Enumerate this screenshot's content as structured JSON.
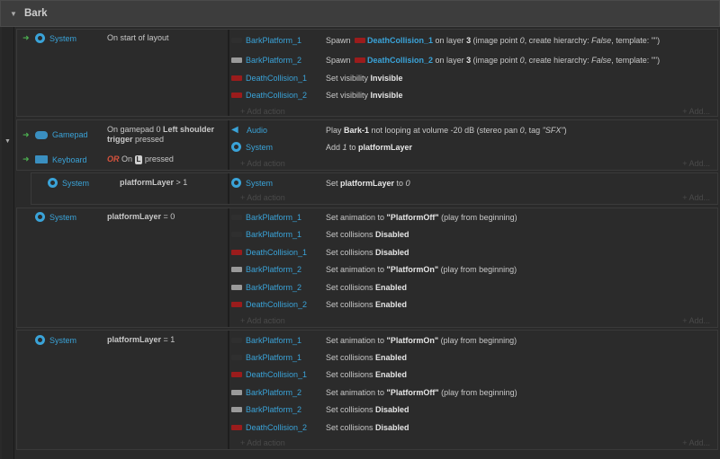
{
  "group": {
    "toggle": "▼",
    "title": "Bark"
  },
  "gutter": {
    "arrow": "▼"
  },
  "labels": {
    "add_action": "+ Add action",
    "add_more": "+ Add..."
  },
  "events": [
    {
      "conditions": [
        {
          "trigger": "➜",
          "icon": "gear-icon",
          "object": "System",
          "desc": "On start of layout"
        }
      ],
      "actions": [
        {
          "thumb": "dark",
          "object": "BarkPlatform_1"
        },
        {
          "thumb": "grey",
          "object": "BarkPlatform_2"
        },
        {
          "thumb": "red",
          "object": "DeathCollision_1",
          "text": [
            "Set visibility ",
            "Invisible"
          ]
        },
        {
          "thumb": "red",
          "object": "DeathCollision_2",
          "text": [
            "Set visibility ",
            "Invisible"
          ]
        }
      ],
      "spawn1": [
        "Spawn ",
        "DeathCollision_1",
        " on layer ",
        "3",
        " (image point ",
        "0",
        ", create hierarchy: ",
        "False",
        ", template: \"\")"
      ],
      "spawn2": [
        "Spawn ",
        "DeathCollision_2",
        " on layer ",
        "3",
        " (image point ",
        "0",
        ", create hierarchy: ",
        "False",
        ", template: \"\")"
      ]
    },
    {
      "conditions": [
        {
          "trigger": "➜",
          "icon": "gamepad-icon",
          "object": "Gamepad",
          "desc_a": "On gamepad 0 ",
          "desc_b": "Left shoulder trigger",
          "desc_c": " pressed"
        },
        {
          "trigger": "➜",
          "icon": "keyboard-icon",
          "object": "Keyboard",
          "or": "OR",
          "on": " On ",
          "key": "L",
          "pressed": " pressed"
        }
      ],
      "actions": [
        {
          "icon": "audio-icon",
          "object": "Audio",
          "text": [
            "Play ",
            "Bark-1",
            " not looping at volume -20 dB (stereo pan ",
            "0",
            ", tag ",
            "\"SFX\"",
            ")"
          ]
        },
        {
          "icon": "gear-icon",
          "object": "System",
          "text": [
            "Add ",
            "1",
            " to ",
            "platformLayer"
          ]
        }
      ]
    },
    {
      "conditions": [
        {
          "icon": "gear-icon",
          "object": "System",
          "var": "platformLayer",
          "op": " > 1"
        }
      ],
      "actions": [
        {
          "icon": "gear-icon",
          "object": "System",
          "text": [
            "Set ",
            "platformLayer",
            " to ",
            "0"
          ]
        }
      ]
    },
    {
      "conditions": [
        {
          "icon": "gear-icon",
          "object": "System",
          "var": "platformLayer",
          "op": " = 0"
        }
      ],
      "actions": [
        {
          "thumb": "dark",
          "object": "BarkPlatform_1",
          "text": [
            "Set animation to ",
            "\"PlatformOff\"",
            " (play from beginning)"
          ]
        },
        {
          "thumb": "dark",
          "object": "BarkPlatform_1",
          "text": [
            "Set collisions ",
            "Disabled"
          ]
        },
        {
          "thumb": "red",
          "object": "DeathCollision_1",
          "text": [
            "Set collisions ",
            "Disabled"
          ]
        },
        {
          "thumb": "grey",
          "object": "BarkPlatform_2",
          "text": [
            "Set animation to ",
            "\"PlatformOn\"",
            " (play from beginning)"
          ]
        },
        {
          "thumb": "grey",
          "object": "BarkPlatform_2",
          "text": [
            "Set collisions ",
            "Enabled"
          ]
        },
        {
          "thumb": "red",
          "object": "DeathCollision_2",
          "text": [
            "Set collisions ",
            "Enabled"
          ]
        }
      ]
    },
    {
      "conditions": [
        {
          "icon": "gear-icon",
          "object": "System",
          "var": "platformLayer",
          "op": " = 1"
        }
      ],
      "actions": [
        {
          "thumb": "dark",
          "object": "BarkPlatform_1",
          "text": [
            "Set animation to ",
            "\"PlatformOn\"",
            " (play from beginning)"
          ]
        },
        {
          "thumb": "dark",
          "object": "BarkPlatform_1",
          "text": [
            "Set collisions ",
            "Enabled"
          ]
        },
        {
          "thumb": "red",
          "object": "DeathCollision_1",
          "text": [
            "Set collisions ",
            "Enabled"
          ]
        },
        {
          "thumb": "grey",
          "object": "BarkPlatform_2",
          "text": [
            "Set animation to ",
            "\"PlatformOff\"",
            " (play from beginning)"
          ]
        },
        {
          "thumb": "grey",
          "object": "BarkPlatform_2",
          "text": [
            "Set collisions ",
            "Disabled"
          ]
        },
        {
          "thumb": "red",
          "object": "DeathCollision_2",
          "text": [
            "Set collisions ",
            "Disabled"
          ]
        }
      ]
    }
  ]
}
